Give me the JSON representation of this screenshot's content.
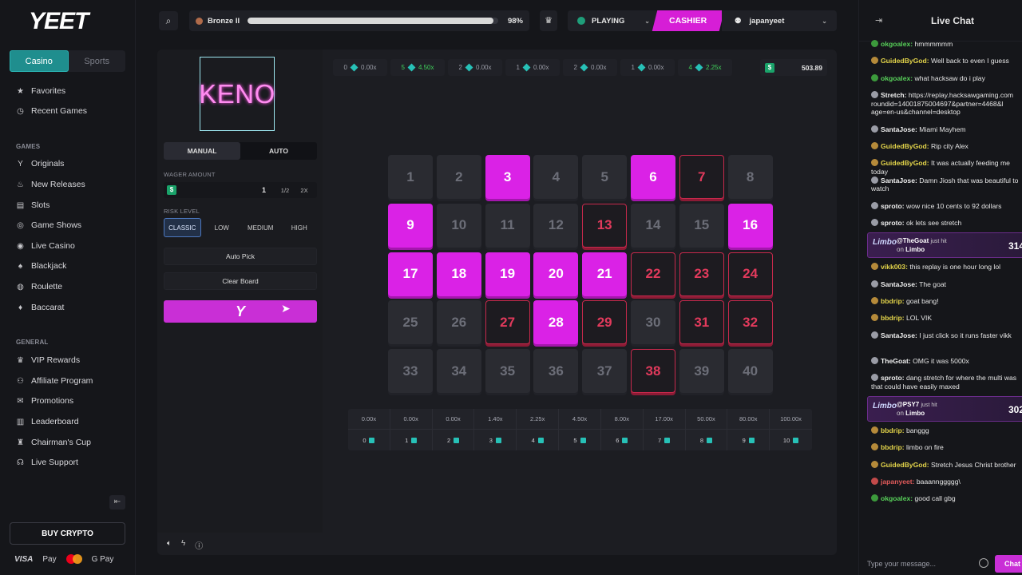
{
  "brand": {
    "logo": "YEET"
  },
  "sidebar": {
    "tabs": [
      "Casino",
      "Sports"
    ],
    "top_items": [
      {
        "label": "Favorites",
        "icon": "star-icon"
      },
      {
        "label": "Recent Games",
        "icon": "clock-icon"
      }
    ],
    "games_section": "GAMES",
    "games_items": [
      {
        "label": "Originals",
        "icon": "yeet-icon"
      },
      {
        "label": "New Releases",
        "icon": "fire-icon"
      },
      {
        "label": "Slots",
        "icon": "slots-icon"
      },
      {
        "label": "Game Shows",
        "icon": "gameshow-icon"
      },
      {
        "label": "Live Casino",
        "icon": "live-icon"
      },
      {
        "label": "Blackjack",
        "icon": "cards-icon"
      },
      {
        "label": "Roulette",
        "icon": "roulette-icon"
      },
      {
        "label": "Baccarat",
        "icon": "baccarat-icon"
      }
    ],
    "general_section": "GENERAL",
    "general_items": [
      {
        "label": "VIP Rewards",
        "icon": "vip-icon"
      },
      {
        "label": "Affiliate Program",
        "icon": "affiliate-icon"
      },
      {
        "label": "Promotions",
        "icon": "promo-icon"
      },
      {
        "label": "Leaderboard",
        "icon": "leaderboard-icon"
      },
      {
        "label": "Chairman's Cup",
        "icon": "cup-icon"
      },
      {
        "label": "Live Support",
        "icon": "headset-icon"
      }
    ],
    "buy_crypto": "BUY CRYPTO",
    "payments": [
      "VISA",
      "Pay",
      "G Pay"
    ]
  },
  "topbar": {
    "rank_name": "Bronze II",
    "rank_progress_pct": "98%",
    "rank_progress": 0.98,
    "playing": "PLAYING",
    "cashier": "CASHIER",
    "username": "japanyeet"
  },
  "game": {
    "title": "KENO",
    "mode_tabs": [
      "MANUAL",
      "AUTO"
    ],
    "wager_label": "WAGER AMOUNT",
    "wager_currency": "$",
    "wager_value": "1",
    "half": "1/2",
    "double": "2X",
    "risk_label": "RISK LEVEL",
    "risk_levels": [
      "CLASSIC",
      "LOW",
      "MEDIUM",
      "HIGH"
    ],
    "auto_pick": "Auto Pick",
    "clear_board": "Clear Board",
    "bet_symbol": "Y",
    "history": [
      {
        "hits": "0",
        "mult": "0.00x",
        "win": false
      },
      {
        "hits": "5",
        "mult": "4.50x",
        "win": true
      },
      {
        "hits": "2",
        "mult": "0.00x",
        "win": false
      },
      {
        "hits": "1",
        "mult": "0.00x",
        "win": false
      },
      {
        "hits": "2",
        "mult": "0.00x",
        "win": false
      },
      {
        "hits": "1",
        "mult": "0.00x",
        "win": false
      },
      {
        "hits": "4",
        "mult": "2.25x",
        "win": true
      }
    ],
    "balance_currency": "$",
    "balance": "503.89",
    "grid": [
      {
        "n": "1",
        "s": "n"
      },
      {
        "n": "2",
        "s": "n"
      },
      {
        "n": "3",
        "s": "p"
      },
      {
        "n": "4",
        "s": "n"
      },
      {
        "n": "5",
        "s": "n"
      },
      {
        "n": "6",
        "s": "p"
      },
      {
        "n": "7",
        "s": "m"
      },
      {
        "n": "8",
        "s": "n"
      },
      {
        "n": "9",
        "s": "p"
      },
      {
        "n": "10",
        "s": "n"
      },
      {
        "n": "11",
        "s": "n"
      },
      {
        "n": "12",
        "s": "n"
      },
      {
        "n": "13",
        "s": "m"
      },
      {
        "n": "14",
        "s": "n"
      },
      {
        "n": "15",
        "s": "n"
      },
      {
        "n": "16",
        "s": "p"
      },
      {
        "n": "17",
        "s": "p"
      },
      {
        "n": "18",
        "s": "p"
      },
      {
        "n": "19",
        "s": "p"
      },
      {
        "n": "20",
        "s": "p"
      },
      {
        "n": "21",
        "s": "p"
      },
      {
        "n": "22",
        "s": "m"
      },
      {
        "n": "23",
        "s": "m"
      },
      {
        "n": "24",
        "s": "m"
      },
      {
        "n": "25",
        "s": "n"
      },
      {
        "n": "26",
        "s": "n"
      },
      {
        "n": "27",
        "s": "m"
      },
      {
        "n": "28",
        "s": "p"
      },
      {
        "n": "29",
        "s": "m"
      },
      {
        "n": "30",
        "s": "n"
      },
      {
        "n": "31",
        "s": "m"
      },
      {
        "n": "32",
        "s": "m"
      },
      {
        "n": "33",
        "s": "n"
      },
      {
        "n": "34",
        "s": "n"
      },
      {
        "n": "35",
        "s": "n"
      },
      {
        "n": "36",
        "s": "n"
      },
      {
        "n": "37",
        "s": "n"
      },
      {
        "n": "38",
        "s": "m"
      },
      {
        "n": "39",
        "s": "n"
      },
      {
        "n": "40",
        "s": "n"
      }
    ],
    "payout_table": [
      {
        "mult": "0.00x",
        "hits": "0"
      },
      {
        "mult": "0.00x",
        "hits": "1"
      },
      {
        "mult": "0.00x",
        "hits": "2"
      },
      {
        "mult": "1.40x",
        "hits": "3"
      },
      {
        "mult": "2.25x",
        "hits": "4"
      },
      {
        "mult": "4.50x",
        "hits": "5"
      },
      {
        "mult": "8.00x",
        "hits": "6"
      },
      {
        "mult": "17.00x",
        "hits": "7"
      },
      {
        "mult": "50.00x",
        "hits": "8"
      },
      {
        "mult": "80.00x",
        "hits": "9"
      },
      {
        "mult": "100.00x",
        "hits": "10"
      }
    ]
  },
  "chat": {
    "title": "Live Chat",
    "messages": [
      {
        "user": "okgoalex:",
        "text": "hmmmmmm",
        "c": "gr"
      },
      {
        "user": "GuidedByGod:",
        "text": "Well back to even I guess",
        "c": "y"
      },
      {
        "user": "okgoalex:",
        "text": "what hacksaw do i play",
        "c": "gr"
      },
      {
        "user": "Stretch:",
        "text": "https://replay.hacksawgaming.com roundid=14001875004697&partner=4468&l age=en-us&channel=desktop",
        "c": "wh"
      },
      {
        "user": "SantaJose:",
        "text": "Miami Mayhem",
        "c": "wh"
      },
      {
        "user": "GuidedByGod:",
        "text": "Rip city Alex",
        "c": "y"
      },
      {
        "user": "GuidedByGod:",
        "text": "It was actually feeding me today",
        "c": "y"
      },
      {
        "user": "SantaJose:",
        "text": "Damn Jiosh that was beautiful to watch",
        "c": "wh"
      },
      {
        "user": "sproto:",
        "text": "wow nice 10 cents to 92 dollars",
        "c": "wh"
      },
      {
        "user": "sproto:",
        "text": "ok lets see stretch",
        "c": "wh"
      },
      {
        "user": "vikk003:",
        "text": "this replay is one hour long lol",
        "c": "y"
      },
      {
        "user": "SantaJose:",
        "text": "The goat",
        "c": "wh"
      },
      {
        "user": "bbdrip:",
        "text": "goat bang!",
        "c": "y"
      },
      {
        "user": "bbdrip:",
        "text": "LOL VIK",
        "c": "y"
      },
      {
        "user": "SantaJose:",
        "text": "I just click so it runs faster vikk",
        "c": "wh"
      },
      {
        "user": "TheGoat:",
        "text": "OMG it was 5000x",
        "c": "wh"
      },
      {
        "user": "sproto:",
        "text": "dang stretch for where the multi was that could have easily maxed",
        "c": "wh"
      },
      {
        "user": "bbdrip:",
        "text": "banggg",
        "c": "y"
      },
      {
        "user": "bbdrip:",
        "text": "limbo on fire",
        "c": "y"
      },
      {
        "user": "GuidedByGod:",
        "text": "Stretch Jesus Christ brother",
        "c": "y"
      },
      {
        "user": "japanyeet:",
        "text": "baaannggggg\\",
        "c": "rd"
      },
      {
        "user": "okgoalex:",
        "text": "good call gbg",
        "c": "gr"
      }
    ],
    "wins": [
      {
        "game_logo": "Limbo",
        "user": "@TheGoat",
        "just_hit": "just hit",
        "on": "on",
        "game": "Limbo",
        "amount": "314"
      },
      {
        "game_logo": "Limbo",
        "user": "@PSY7",
        "just_hit": "just hit",
        "on": "on",
        "game": "Limbo",
        "amount": "302"
      }
    ],
    "input_placeholder": "Type your message...",
    "send": "Chat"
  }
}
